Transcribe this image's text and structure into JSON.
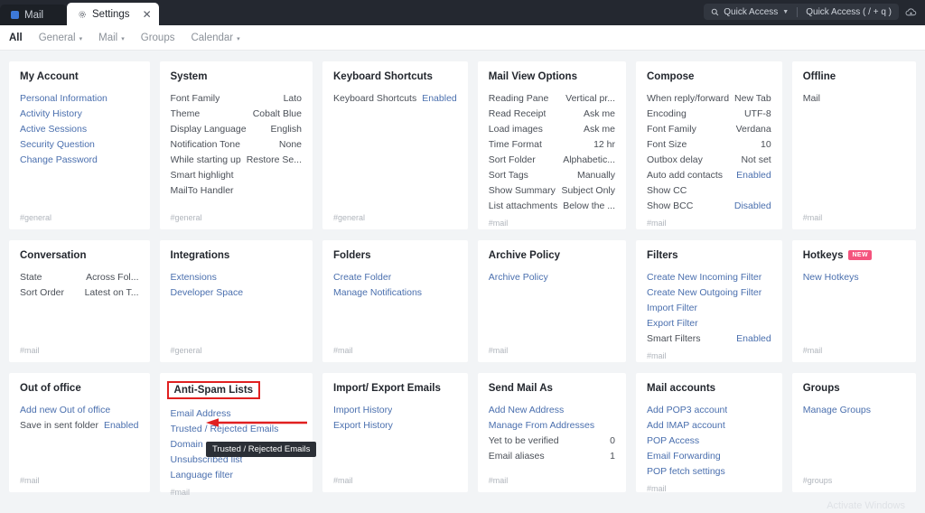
{
  "window": {
    "tabs": [
      {
        "label": "Mail",
        "icon": "mail-square-icon",
        "active": false,
        "closable": false
      },
      {
        "label": "Settings",
        "icon": "gear-icon",
        "active": true,
        "closable": true
      }
    ],
    "quick_access": {
      "search_label": "Quick Access",
      "shortcut_label": "Quick Access ( / + q )",
      "search_icon": "search-icon",
      "caret_icon": "chevron-down-icon",
      "cloud_icon": "cloud-icon"
    }
  },
  "filter_nav": [
    {
      "label": "All",
      "active": true,
      "has_caret": false
    },
    {
      "label": "General",
      "active": false,
      "has_caret": true
    },
    {
      "label": "Mail",
      "active": false,
      "has_caret": true
    },
    {
      "label": "Groups",
      "active": false,
      "has_caret": false
    },
    {
      "label": "Calendar",
      "active": false,
      "has_caret": true
    }
  ],
  "colors": {
    "link": "#4a6fae",
    "annotation_red": "#e02020",
    "badge_pink": "#f4537d",
    "titlebar": "#242830",
    "page_bg": "#f2f4f6"
  },
  "annotations": {
    "highlight_box_target": "Anti-Spam Lists",
    "arrow_target": "Email Address",
    "tooltip_text": "Trusted / Rejected Emails"
  },
  "watermark": "Activate Windows",
  "cards": [
    {
      "title": "My Account",
      "tag": "#general",
      "rows": [
        {
          "label": "Personal Information",
          "value": "",
          "label_link": true
        },
        {
          "label": "Activity History",
          "value": "",
          "label_link": true
        },
        {
          "label": "Active Sessions",
          "value": "",
          "label_link": true
        },
        {
          "label": "Security Question",
          "value": "",
          "label_link": true
        },
        {
          "label": "Change Password",
          "value": "",
          "label_link": true
        }
      ]
    },
    {
      "title": "System",
      "tag": "#general",
      "rows": [
        {
          "label": "Font Family",
          "value": "Lato"
        },
        {
          "label": "Theme",
          "value": "Cobalt Blue"
        },
        {
          "label": "Display Language",
          "value": "English"
        },
        {
          "label": "Notification Tone",
          "value": "None"
        },
        {
          "label": "While starting up",
          "value": "Restore Se..."
        },
        {
          "label": "Smart highlight",
          "value": ""
        },
        {
          "label": "MailTo Handler",
          "value": ""
        }
      ]
    },
    {
      "title": "Keyboard Shortcuts",
      "tag": "#general",
      "rows": [
        {
          "label": "Keyboard Shortcuts",
          "value": "Enabled",
          "value_link": true
        }
      ]
    },
    {
      "title": "Mail View Options",
      "tag": "#mail",
      "rows": [
        {
          "label": "Reading Pane",
          "value": "Vertical pr..."
        },
        {
          "label": "Read Receipt",
          "value": "Ask me"
        },
        {
          "label": "Load images",
          "value": "Ask me"
        },
        {
          "label": "Time Format",
          "value": "12 hr"
        },
        {
          "label": "Sort Folder",
          "value": "Alphabetic..."
        },
        {
          "label": "Sort Tags",
          "value": "Manually"
        },
        {
          "label": "Show Summary",
          "value": "Subject Only"
        },
        {
          "label": "List attachments",
          "value": "Below the ..."
        }
      ]
    },
    {
      "title": "Compose",
      "tag": "#mail",
      "rows": [
        {
          "label": "When reply/forward",
          "value": "New Tab"
        },
        {
          "label": "Encoding",
          "value": "UTF-8"
        },
        {
          "label": "Font Family",
          "value": "Verdana"
        },
        {
          "label": "Font Size",
          "value": "10"
        },
        {
          "label": "Outbox delay",
          "value": "Not set"
        },
        {
          "label": "Auto add contacts",
          "value": "Enabled",
          "value_link": true
        },
        {
          "label": "Show CC",
          "value": ""
        },
        {
          "label": "Show BCC",
          "value": "Disabled",
          "value_link": true
        }
      ]
    },
    {
      "title": "Offline",
      "tag": "#mail",
      "rows": [
        {
          "label": "Mail",
          "value": ""
        }
      ]
    },
    {
      "title": "Conversation",
      "tag": "#mail",
      "rows": [
        {
          "label": "State",
          "value": "Across Fol..."
        },
        {
          "label": "Sort Order",
          "value": "Latest on T..."
        }
      ]
    },
    {
      "title": "Integrations",
      "tag": "#general",
      "rows": [
        {
          "label": "Extensions",
          "value": "",
          "label_link": true
        },
        {
          "label": "Developer Space",
          "value": "",
          "label_link": true
        }
      ]
    },
    {
      "title": "Folders",
      "tag": "#mail",
      "rows": [
        {
          "label": "Create Folder",
          "value": "",
          "label_link": true
        },
        {
          "label": "Manage Notifications",
          "value": "",
          "label_link": true
        }
      ]
    },
    {
      "title": "Archive Policy",
      "tag": "#mail",
      "rows": [
        {
          "label": "Archive Policy",
          "value": "",
          "label_link": true
        }
      ]
    },
    {
      "title": "Filters",
      "tag": "#mail",
      "rows": [
        {
          "label": "Create New Incoming Filter",
          "value": "",
          "label_link": true
        },
        {
          "label": "Create New Outgoing Filter",
          "value": "",
          "label_link": true
        },
        {
          "label": "Import Filter",
          "value": "",
          "label_link": true
        },
        {
          "label": "Export Filter",
          "value": "",
          "label_link": true
        },
        {
          "label": "Smart Filters",
          "value": "Enabled",
          "value_link": true
        }
      ]
    },
    {
      "title": "Hotkeys",
      "tag": "#mail",
      "badge": "NEW",
      "rows": [
        {
          "label": "New Hotkeys",
          "value": "",
          "label_link": true
        }
      ]
    },
    {
      "title": "Out of office",
      "tag": "#mail",
      "rows": [
        {
          "label": "Add new Out of office",
          "value": "",
          "label_link": true
        },
        {
          "label": "Save in sent folder",
          "value": "Enabled",
          "value_link": true
        }
      ]
    },
    {
      "title": "Anti-Spam Lists",
      "tag": "#mail",
      "highlighted": true,
      "rows": [
        {
          "label": "Email Address",
          "value": "",
          "label_link": true
        },
        {
          "label": "Trusted / Rejected Emails",
          "value": "",
          "label_link": true
        },
        {
          "label": "Domain",
          "value": "",
          "label_link": true
        },
        {
          "label": "Unsubscribed list",
          "value": "",
          "label_link": true
        },
        {
          "label": "Language filter",
          "value": "",
          "label_link": true
        }
      ]
    },
    {
      "title": "Import/ Export Emails",
      "tag": "#mail",
      "rows": [
        {
          "label": "Import History",
          "value": "",
          "label_link": true
        },
        {
          "label": "Export History",
          "value": "",
          "label_link": true
        }
      ]
    },
    {
      "title": "Send Mail As",
      "tag": "#mail",
      "rows": [
        {
          "label": "Add New Address",
          "value": "",
          "label_link": true
        },
        {
          "label": "Manage From Addresses",
          "value": "",
          "label_link": true
        },
        {
          "label": "Yet to be verified",
          "value": "0"
        },
        {
          "label": "Email aliases",
          "value": "1"
        }
      ]
    },
    {
      "title": "Mail accounts",
      "tag": "#mail",
      "rows": [
        {
          "label": "Add POP3 account",
          "value": "",
          "label_link": true
        },
        {
          "label": "Add IMAP account",
          "value": "",
          "label_link": true
        },
        {
          "label": "POP Access",
          "value": "",
          "label_link": true
        },
        {
          "label": "Email Forwarding",
          "value": "",
          "label_link": true
        },
        {
          "label": "POP fetch settings",
          "value": "",
          "label_link": true
        }
      ]
    },
    {
      "title": "Groups",
      "tag": "#groups",
      "rows": [
        {
          "label": "Manage Groups",
          "value": "",
          "label_link": true
        }
      ]
    }
  ]
}
